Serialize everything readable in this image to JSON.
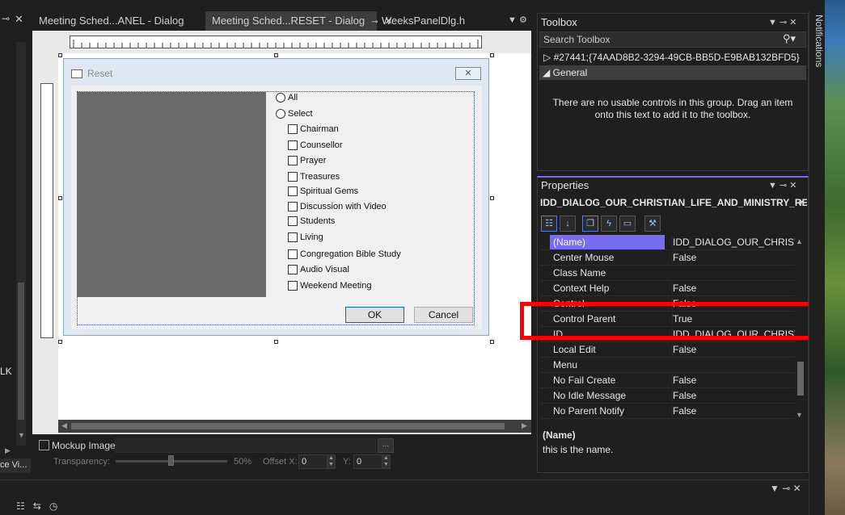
{
  "tabs": [
    {
      "label": "Meeting Sched...ANEL - Dialog",
      "active": false
    },
    {
      "label": "Meeting Sched...RESET - Dialog",
      "active": true
    },
    {
      "label": "WeeksPanelDlg.h",
      "active": false
    }
  ],
  "left_panel": {
    "text_fragment": "LK",
    "tab_label": "ce Vi..."
  },
  "dialog": {
    "title": "Reset",
    "close_glyph": "✕",
    "radios": [
      {
        "label": "All"
      },
      {
        "label": "Select"
      }
    ],
    "checkboxes": [
      "Chairman",
      "Counsellor",
      "Prayer",
      "Treasures",
      "Spiritual Gems",
      "Discussion with Video",
      "Students",
      "Living",
      "Congregation Bible Study",
      "Audio Visual",
      "Weekend Meeting"
    ],
    "ok_label": "OK",
    "cancel_label": "Cancel"
  },
  "mockup": {
    "checkbox_label": "Mockup Image:",
    "browse_label": "...",
    "transparency_label": "Transparency:",
    "transparency_percent": "50%",
    "offset_x_label": "Offset X:",
    "offset_x_value": "0",
    "offset_y_label": "Y:",
    "offset_y_value": "0"
  },
  "toolbox": {
    "title": "Toolbox",
    "search_placeholder": "Search Toolbox",
    "group1": "#27441;{74AAD8B2-3294-49CB-BB5D-E9BAB132BFD5}",
    "group2": "General",
    "empty_message": "There are no usable controls in this group. Drag an item onto this text to add it to the toolbox."
  },
  "properties": {
    "title": "Properties",
    "object": "IDD_DIALOG_OUR_CHRISTIAN_LIFE_AND_MINISTRY_RES",
    "rows": [
      {
        "name": "(Name)",
        "value": "IDD_DIALOG_OUR_CHRISTIA",
        "selected": true
      },
      {
        "name": "Center Mouse",
        "value": "False"
      },
      {
        "name": "Class Name",
        "value": ""
      },
      {
        "name": "Context Help",
        "value": "False"
      },
      {
        "name": "Control",
        "value": "False"
      },
      {
        "name": "Control Parent",
        "value": "True"
      },
      {
        "name": "ID",
        "value": "IDD_DIALOG_OUR_CHRISTIA"
      },
      {
        "name": "Local Edit",
        "value": "False"
      },
      {
        "name": "Menu",
        "value": ""
      },
      {
        "name": "No Fail Create",
        "value": "False"
      },
      {
        "name": "No Idle Message",
        "value": "False"
      },
      {
        "name": "No Parent Notify",
        "value": "False"
      }
    ],
    "description_title": "(Name)",
    "description_text": "this is the name."
  },
  "notifications_label": "Notifications",
  "colors": {
    "accent": "#7a6cf0",
    "highlight": "#ff0000",
    "dialog_bg": "#dfe8f2"
  }
}
